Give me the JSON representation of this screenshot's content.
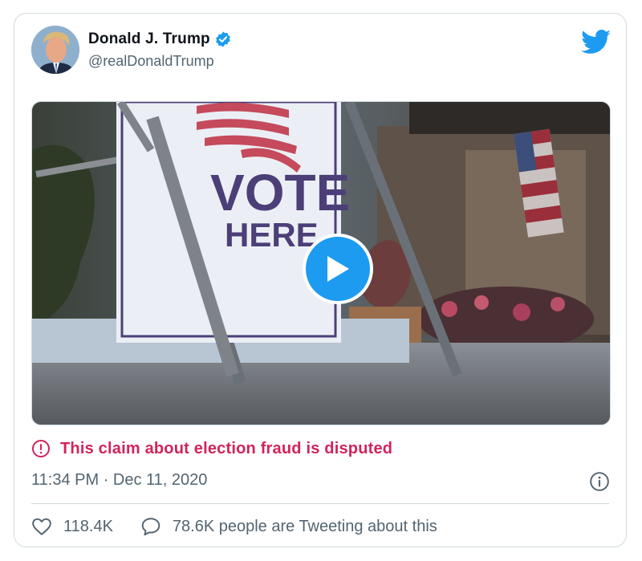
{
  "tweet": {
    "author_name": "Donald J. Trump",
    "author_handle": "@realDonaldTrump",
    "verified": true,
    "warning_text": "This claim about election fraud is disputed",
    "timestamp": "11:34 PM · Dec 11, 2020",
    "likes_count": "118.4K",
    "replies_text": "78.6K people are Tweeting about this",
    "media_sign_text": [
      "VOTE",
      "HERE"
    ]
  },
  "colors": {
    "brand_blue": "#1d9bf0",
    "warning_pink": "#d1245a",
    "secondary_text": "#536471",
    "border": "#cfd9de"
  },
  "icons": {
    "verified": "verified-badge-icon",
    "logo": "twitter-bird-icon",
    "play": "play-icon",
    "warning": "exclamation-circle-icon",
    "info": "info-icon",
    "like": "heart-icon",
    "reply": "speech-bubble-icon"
  }
}
